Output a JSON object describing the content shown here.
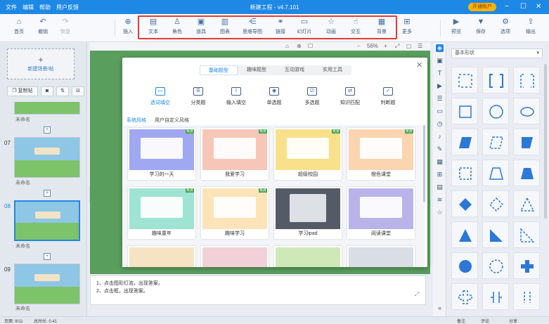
{
  "app": {
    "menu": [
      "文件",
      "编辑",
      "帮助",
      "用户反馈"
    ],
    "title": "新建工程 - v4.7.101",
    "vip_label": "开通账户"
  },
  "toolbar": {
    "left": [
      {
        "label": "首页",
        "icon": "home-icon",
        "enabled": true
      },
      {
        "label": "撤销",
        "icon": "undo-icon",
        "enabled": true
      },
      {
        "label": "恢复",
        "icon": "redo-icon",
        "enabled": false
      }
    ],
    "insert": {
      "label": "插入",
      "icon": "plus-circle-icon"
    },
    "highlighted": [
      {
        "label": "文本",
        "icon": "text-icon"
      },
      {
        "label": "角色",
        "icon": "character-icon"
      },
      {
        "label": "道具",
        "icon": "prop-icon"
      },
      {
        "label": "图表",
        "icon": "chart-icon"
      },
      {
        "label": "思维导图",
        "icon": "mindmap-icon"
      },
      {
        "label": "链接",
        "icon": "link-icon"
      },
      {
        "label": "幻灯片",
        "icon": "slides-icon"
      },
      {
        "label": "动画",
        "icon": "star-icon"
      },
      {
        "label": "交互",
        "icon": "hand-icon"
      },
      {
        "label": "背景",
        "icon": "background-icon"
      }
    ],
    "more": {
      "label": "更多",
      "icon": "grid-icon"
    },
    "right": [
      {
        "label": "预览",
        "icon": "preview-icon"
      },
      {
        "label": "保存",
        "icon": "save-icon"
      },
      {
        "label": "选项",
        "icon": "settings-icon"
      },
      {
        "label": "输出",
        "icon": "export-icon"
      }
    ]
  },
  "left_panel": {
    "new_scene_label": "新建场景/帖",
    "copy_label": "复制帖",
    "slides": [
      {
        "number": "",
        "name": "未命名",
        "selected": false
      },
      {
        "number": "07",
        "name": "未命名",
        "selected": false
      },
      {
        "number": "08",
        "name": "未命名",
        "selected": true
      },
      {
        "number": "09",
        "name": "未命名",
        "selected": false
      }
    ]
  },
  "canvas_toolbar": [
    "⌂",
    "⊕",
    "☐",
    "−",
    "56%",
    "+",
    "⤢",
    "▢",
    "☰"
  ],
  "modal": {
    "tabs": [
      {
        "label": "基础题型",
        "active": true
      },
      {
        "label": "趣味题型",
        "active": false
      },
      {
        "label": "互动游戏",
        "active": false
      },
      {
        "label": "实用工具",
        "active": false
      }
    ],
    "categories": [
      {
        "label": "选词填空",
        "icon": "fill-blank-icon",
        "active": true
      },
      {
        "label": "分类题",
        "icon": "classify-icon",
        "active": false
      },
      {
        "label": "输入填空",
        "icon": "input-icon",
        "active": false
      },
      {
        "label": "单选题",
        "icon": "radio-icon",
        "active": false
      },
      {
        "label": "多选题",
        "icon": "checkbox-icon",
        "active": false
      },
      {
        "label": "知识匹配",
        "icon": "match-icon",
        "active": false
      },
      {
        "label": "判断题",
        "icon": "judge-icon",
        "active": false
      }
    ],
    "style_tabs": [
      {
        "label": "系统风格",
        "active": true
      },
      {
        "label": "用户自定义风格",
        "active": false
      }
    ],
    "templates": [
      {
        "title": "学习的一天",
        "badge": "免费",
        "color": "#9fa8f0"
      },
      {
        "title": "我爱学习",
        "badge": "免费",
        "color": "#f6c7b8"
      },
      {
        "title": "超级校园",
        "badge": "免费",
        "color": "#f9e08a"
      },
      {
        "title": "橙色课堂",
        "badge": "免费",
        "color": "#fbd4b0"
      },
      {
        "title": "趣味童年",
        "badge": "免费",
        "color": "#9fe3d2"
      },
      {
        "title": "趣味学习",
        "badge": "免费",
        "color": "#fde4b8"
      },
      {
        "title": "学习ipad",
        "badge": "",
        "color": "#555b66"
      },
      {
        "title": "阅读课堂",
        "badge": "",
        "color": "#b9b3ea"
      },
      {
        "title": "",
        "badge": "",
        "color": "#f5e3c3"
      },
      {
        "title": "",
        "badge": "",
        "color": "#f2d0d8"
      },
      {
        "title": "",
        "badge": "",
        "color": "#cfe8b8"
      },
      {
        "title": "",
        "badge": "",
        "color": "#d8dde6"
      }
    ]
  },
  "notes": {
    "lines": [
      "1、点击图形灯泡，出现答案。",
      "2、点击框，出现答案。"
    ]
  },
  "shapes_panel": {
    "category": "基本形状",
    "shapes": [
      "square-dashed",
      "bracket-square",
      "bracket-dashed",
      "square",
      "circle",
      "ellipse",
      "parallelogram",
      "parallelogram-dashed",
      "trapezoid-right",
      "rect-dashed",
      "trapezoid",
      "trapezoid-filled",
      "diamond",
      "diamond-dashed",
      "triangle-dashed",
      "triangle",
      "right-triangle",
      "right-triangle-dashed",
      "circle-filled",
      "circle-dashed",
      "cross",
      "cross-dashed",
      "bracket-v",
      "bracket-v-dashed"
    ]
  },
  "status": {
    "page": "页面: 8/11",
    "duration": "总时长: 0.41",
    "right_items": [
      "备注",
      "评论",
      "分享"
    ]
  },
  "colors": {
    "primary": "#1e88e5",
    "highlight_border": "#e53935",
    "canvas_bg": "#5a9e5e"
  }
}
